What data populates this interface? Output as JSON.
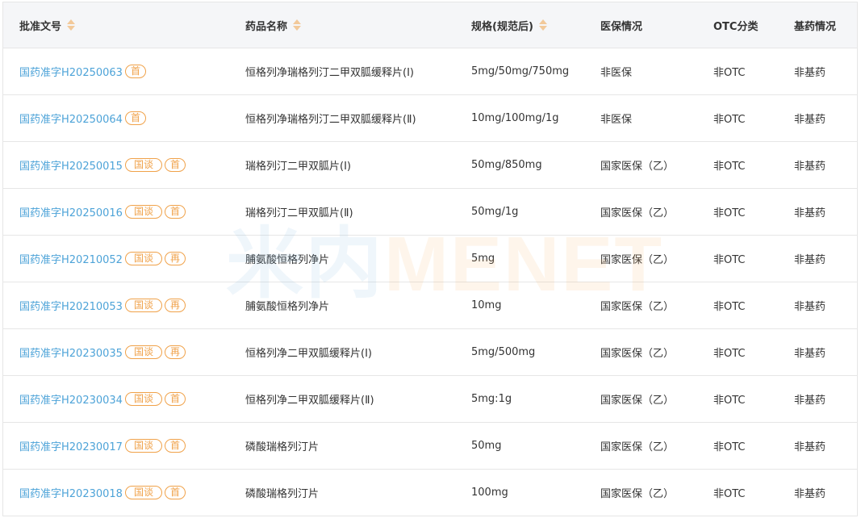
{
  "columns": [
    {
      "label": "批准文号",
      "sortable": true
    },
    {
      "label": "药品名称",
      "sortable": true
    },
    {
      "label": "规格(规范后)",
      "sortable": true
    },
    {
      "label": "医保情况",
      "sortable": false
    },
    {
      "label": "OTC分类",
      "sortable": false
    },
    {
      "label": "基药情况",
      "sortable": false
    }
  ],
  "rows": [
    {
      "approval": "国药准字H20250063",
      "tags": [
        "首"
      ],
      "name": "恒格列净瑞格列汀二甲双胍缓释片(Ⅰ)",
      "spec": "5mg/50mg/750mg",
      "insurance": "非医保",
      "otc": "非OTC",
      "essential": "非基药"
    },
    {
      "approval": "国药准字H20250064",
      "tags": [
        "首"
      ],
      "name": "恒格列净瑞格列汀二甲双胍缓释片(Ⅱ)",
      "spec": "10mg/100mg/1g",
      "insurance": "非医保",
      "otc": "非OTC",
      "essential": "非基药"
    },
    {
      "approval": "国药准字H20250015",
      "tags": [
        "国谈",
        "首"
      ],
      "name": "瑞格列汀二甲双胍片(Ⅰ)",
      "spec": "50mg/850mg",
      "insurance": "国家医保（乙）",
      "otc": "非OTC",
      "essential": "非基药"
    },
    {
      "approval": "国药准字H20250016",
      "tags": [
        "国谈",
        "首"
      ],
      "name": "瑞格列汀二甲双胍片(Ⅱ)",
      "spec": "50mg/1g",
      "insurance": "国家医保（乙）",
      "otc": "非OTC",
      "essential": "非基药"
    },
    {
      "approval": "国药准字H20210052",
      "tags": [
        "国谈",
        "再"
      ],
      "name": "脯氨酸恒格列净片",
      "spec": "5mg",
      "insurance": "国家医保（乙）",
      "otc": "非OTC",
      "essential": "非基药"
    },
    {
      "approval": "国药准字H20210053",
      "tags": [
        "国谈",
        "再"
      ],
      "name": "脯氨酸恒格列净片",
      "spec": "10mg",
      "insurance": "国家医保（乙）",
      "otc": "非OTC",
      "essential": "非基药"
    },
    {
      "approval": "国药准字H20230035",
      "tags": [
        "国谈",
        "再"
      ],
      "name": "恒格列净二甲双胍缓释片(Ⅰ)",
      "spec": "5mg/500mg",
      "insurance": "国家医保（乙）",
      "otc": "非OTC",
      "essential": "非基药"
    },
    {
      "approval": "国药准字H20230034",
      "tags": [
        "国谈",
        "首"
      ],
      "name": "恒格列净二甲双胍缓释片(Ⅱ)",
      "spec": "5mg:1g",
      "insurance": "国家医保（乙）",
      "otc": "非OTC",
      "essential": "非基药"
    },
    {
      "approval": "国药准字H20230017",
      "tags": [
        "国谈",
        "首"
      ],
      "name": "磷酸瑞格列汀片",
      "spec": "50mg",
      "insurance": "国家医保（乙）",
      "otc": "非OTC",
      "essential": "非基药"
    },
    {
      "approval": "国药准字H20230018",
      "tags": [
        "国谈",
        "首"
      ],
      "name": "磷酸瑞格列汀片",
      "spec": "100mg",
      "insurance": "国家医保（乙）",
      "otc": "非OTC",
      "essential": "非基药"
    }
  ],
  "watermark": {
    "part1": "米内",
    "part2": "MENET"
  },
  "colors": {
    "link": "#4da3d8",
    "tag": "#f0a24a",
    "header_bg": "#f5f6f8",
    "border": "#e6e6e6",
    "sort_icon": "#f2c99a"
  }
}
